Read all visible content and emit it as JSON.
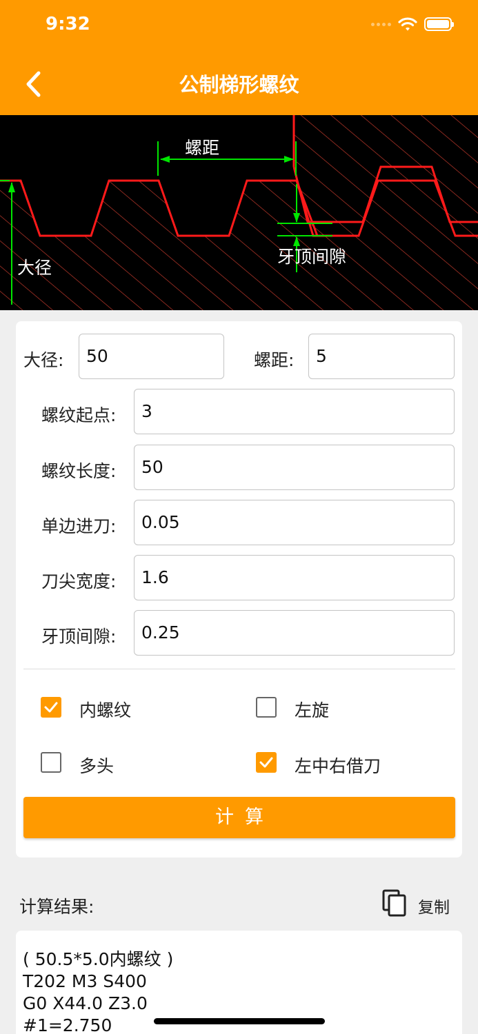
{
  "status_bar": {
    "time": "9:32"
  },
  "header": {
    "title": "公制梯形螺纹"
  },
  "diagram": {
    "labels": {
      "pitch": "螺距",
      "major_diameter": "大径",
      "crest_clearance": "牙顶间隙"
    }
  },
  "form": {
    "major_diameter": {
      "label": "大径:",
      "value": "50"
    },
    "pitch": {
      "label": "螺距:",
      "value": "5"
    },
    "thread_start": {
      "label": "螺纹起点:",
      "value": "3"
    },
    "thread_length": {
      "label": "螺纹长度:",
      "value": "50"
    },
    "feed_per_side": {
      "label": "单边进刀:",
      "value": "0.05"
    },
    "tool_tip_width": {
      "label": "刀尖宽度:",
      "value": "1.6"
    },
    "crest_clearance": {
      "label": "牙顶间隙:",
      "value": "0.25"
    },
    "options": {
      "internal_thread": {
        "label": "内螺纹",
        "checked": true
      },
      "left_hand": {
        "label": "左旋",
        "checked": false
      },
      "multi_start": {
        "label": "多头",
        "checked": false
      },
      "lcr_borrow": {
        "label": "左中右借刀",
        "checked": true
      }
    },
    "calculate_label": "计算"
  },
  "result": {
    "label": "计算结果:",
    "copy_label": "复制",
    "lines": [
      "( 50.5*5.0内螺纹 )",
      "T202 M3 S400",
      "G0 X44.0 Z3.0",
      "#1=2.750"
    ]
  },
  "colors": {
    "accent": "#ff9a00",
    "profile_line": "#ff1a1a",
    "dimension_line": "#00e600",
    "hatch": "#c0392b"
  }
}
